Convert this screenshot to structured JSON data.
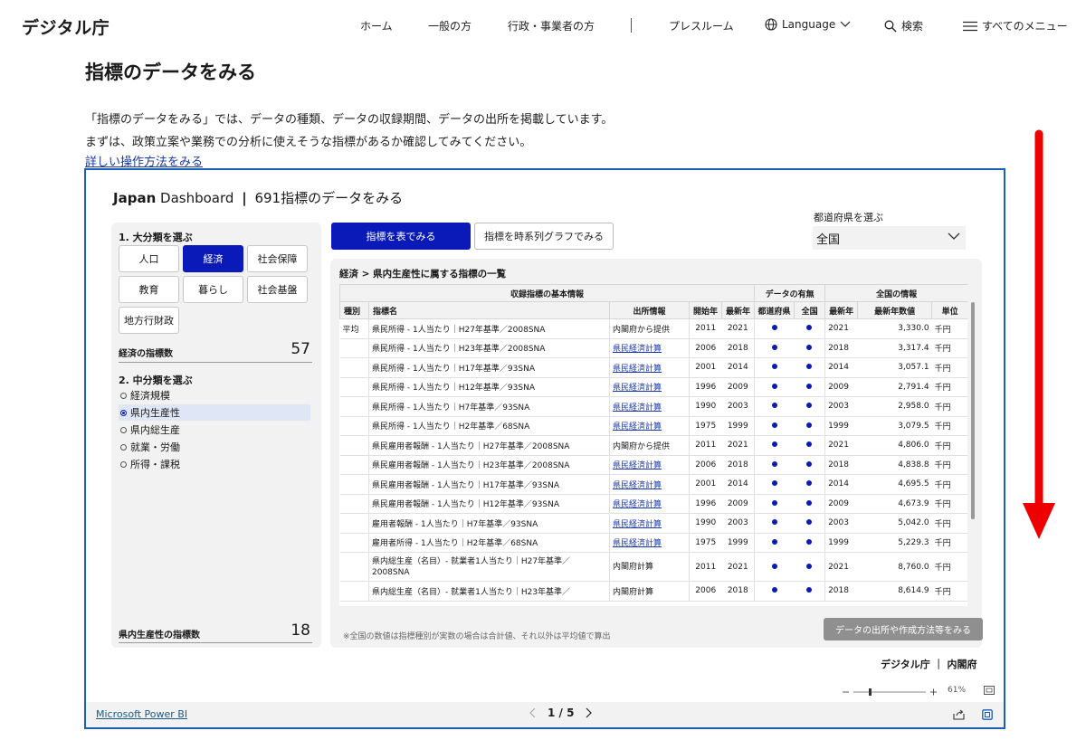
{
  "header": {
    "logo": "デジタル庁",
    "nav": [
      "ホーム",
      "一般の方",
      "行政・事業者の方",
      "プレスルーム"
    ],
    "language_label": "Language",
    "search_label": "検索",
    "menu_label": "すべてのメニュー"
  },
  "page": {
    "title": "指標のデータをみる",
    "intro_line1": "「指標のデータをみる」では、データの種類、データの収録期間、データの出所を掲載しています。",
    "intro_line2": "まずは、政策立案や業務での分析に使えそうな指標があるか確認してみてください。",
    "help_link": "詳しい操作方法をみる"
  },
  "dashboard": {
    "brand_bold": "Japan",
    "brand_rest": "Dashboard",
    "subtitle": "691指標のデータをみる",
    "category_heading": "1. 大分類を選ぶ",
    "categories": [
      "人口",
      "経済",
      "社会保障",
      "教育",
      "暮らし",
      "社会基盤",
      "地方行財政"
    ],
    "active_category": "経済",
    "category_count_label": "経済の指標数",
    "category_count": "57",
    "subcategory_heading": "2. 中分類を選ぶ",
    "subcategories": [
      "経済規模",
      "県内生産性",
      "県内総生産",
      "就業・労働",
      "所得・課税"
    ],
    "active_subcategory": "県内生産性",
    "subcategory_count_label": "県内生産性の指標数",
    "subcategory_count": "18",
    "tab_table": "指標を表でみる",
    "tab_graph": "指標を時系列グラフでみる",
    "pref_label": "都道府県を選ぶ",
    "pref_value": "全国",
    "breadcrumb": "経済 > 県内生産性に属する指標の一覧",
    "group_headers": {
      "basic": "収録指標の基本情報",
      "availability": "データの有無",
      "national": "全国の情報"
    },
    "columns": {
      "type": "種別",
      "name": "指標名",
      "source": "出所情報",
      "start": "開始年",
      "latest": "最新年",
      "pref": "都道府県",
      "nation": "全国",
      "nat_latest": "最新年",
      "nat_value": "最新年数値",
      "unit": "単位"
    },
    "rows": [
      {
        "type": "平均",
        "name": "県民所得 - 1人当たり｜H27年基準／2008SNA",
        "source": "内閣府から提供",
        "link": false,
        "start": "2011",
        "latest": "2021",
        "nat_latest": "2021",
        "value": "3,330.0",
        "unit": "千円"
      },
      {
        "type": "",
        "name": "県民所得 - 1人当たり｜H23年基準／2008SNA",
        "source": "県民経済計算",
        "link": true,
        "start": "2006",
        "latest": "2018",
        "nat_latest": "2018",
        "value": "3,317.4",
        "unit": "千円"
      },
      {
        "type": "",
        "name": "県民所得 - 1人当たり｜H17年基準／93SNA",
        "source": "県民経済計算",
        "link": true,
        "start": "2001",
        "latest": "2014",
        "nat_latest": "2014",
        "value": "3,057.1",
        "unit": "千円"
      },
      {
        "type": "",
        "name": "県民所得 - 1人当たり｜H12年基準／93SNA",
        "source": "県民経済計算",
        "link": true,
        "start": "1996",
        "latest": "2009",
        "nat_latest": "2009",
        "value": "2,791.4",
        "unit": "千円"
      },
      {
        "type": "",
        "name": "県民所得 - 1人当たり｜H7年基準／93SNA",
        "source": "県民経済計算",
        "link": true,
        "start": "1990",
        "latest": "2003",
        "nat_latest": "2003",
        "value": "2,958.0",
        "unit": "千円"
      },
      {
        "type": "",
        "name": "県民所得 - 1人当たり｜H2年基準／68SNA",
        "source": "県民経済計算",
        "link": true,
        "start": "1975",
        "latest": "1999",
        "nat_latest": "1999",
        "value": "3,079.5",
        "unit": "千円"
      },
      {
        "type": "",
        "name": "県民雇用者報酬 - 1人当たり｜H27年基準／2008SNA",
        "source": "内閣府から提供",
        "link": false,
        "start": "2011",
        "latest": "2021",
        "nat_latest": "2021",
        "value": "4,806.0",
        "unit": "千円"
      },
      {
        "type": "",
        "name": "県民雇用者報酬 - 1人当たり｜H23年基準／2008SNA",
        "source": "県民経済計算",
        "link": true,
        "start": "2006",
        "latest": "2018",
        "nat_latest": "2018",
        "value": "4,838.8",
        "unit": "千円"
      },
      {
        "type": "",
        "name": "県民雇用者報酬 - 1人当たり｜H17年基準／93SNA",
        "source": "県民経済計算",
        "link": true,
        "start": "2001",
        "latest": "2014",
        "nat_latest": "2014",
        "value": "4,695.5",
        "unit": "千円"
      },
      {
        "type": "",
        "name": "県民雇用者報酬 - 1人当たり｜H12年基準／93SNA",
        "source": "県民経済計算",
        "link": true,
        "start": "1996",
        "latest": "2009",
        "nat_latest": "2009",
        "value": "4,673.9",
        "unit": "千円"
      },
      {
        "type": "",
        "name": "雇用者報酬 - 1人当たり｜H7年基準／93SNA",
        "source": "県民経済計算",
        "link": true,
        "start": "1990",
        "latest": "2003",
        "nat_latest": "2003",
        "value": "5,042.0",
        "unit": "千円"
      },
      {
        "type": "",
        "name": "雇用者所得 - 1人当たり｜H2年基準／68SNA",
        "source": "県民経済計算",
        "link": true,
        "start": "1975",
        "latest": "1999",
        "nat_latest": "1999",
        "value": "5,229.3",
        "unit": "千円"
      },
      {
        "type": "",
        "name": "県内総生産（名目）- 就業者1人当たり｜H27年基準／2008SNA",
        "source": "内閣府計算",
        "link": false,
        "start": "2011",
        "latest": "2021",
        "nat_latest": "2021",
        "value": "8,760.0",
        "unit": "千円",
        "tall": true
      },
      {
        "type": "",
        "name": "県内総生産（名目）- 就業者1人当たり｜H23年基準／",
        "source": "内閣府計算",
        "link": false,
        "start": "2006",
        "latest": "2018",
        "nat_latest": "2018",
        "value": "8,614.9",
        "unit": "千円"
      }
    ],
    "footnote": "※全国の数値は指標種別が実数の場合は合計値、それ以外は平均値で算出",
    "source_button": "データの出所や作成方法等をみる",
    "credits": "デジタル庁 ｜ 内閣府"
  },
  "powerbi": {
    "zoom": "61%",
    "link": "Microsoft Power BI",
    "page": "1 / 5"
  },
  "colors": {
    "accent": "#0a1ab8",
    "frame": "#1b5fb7",
    "scroll_arrow": "#ee0000"
  }
}
